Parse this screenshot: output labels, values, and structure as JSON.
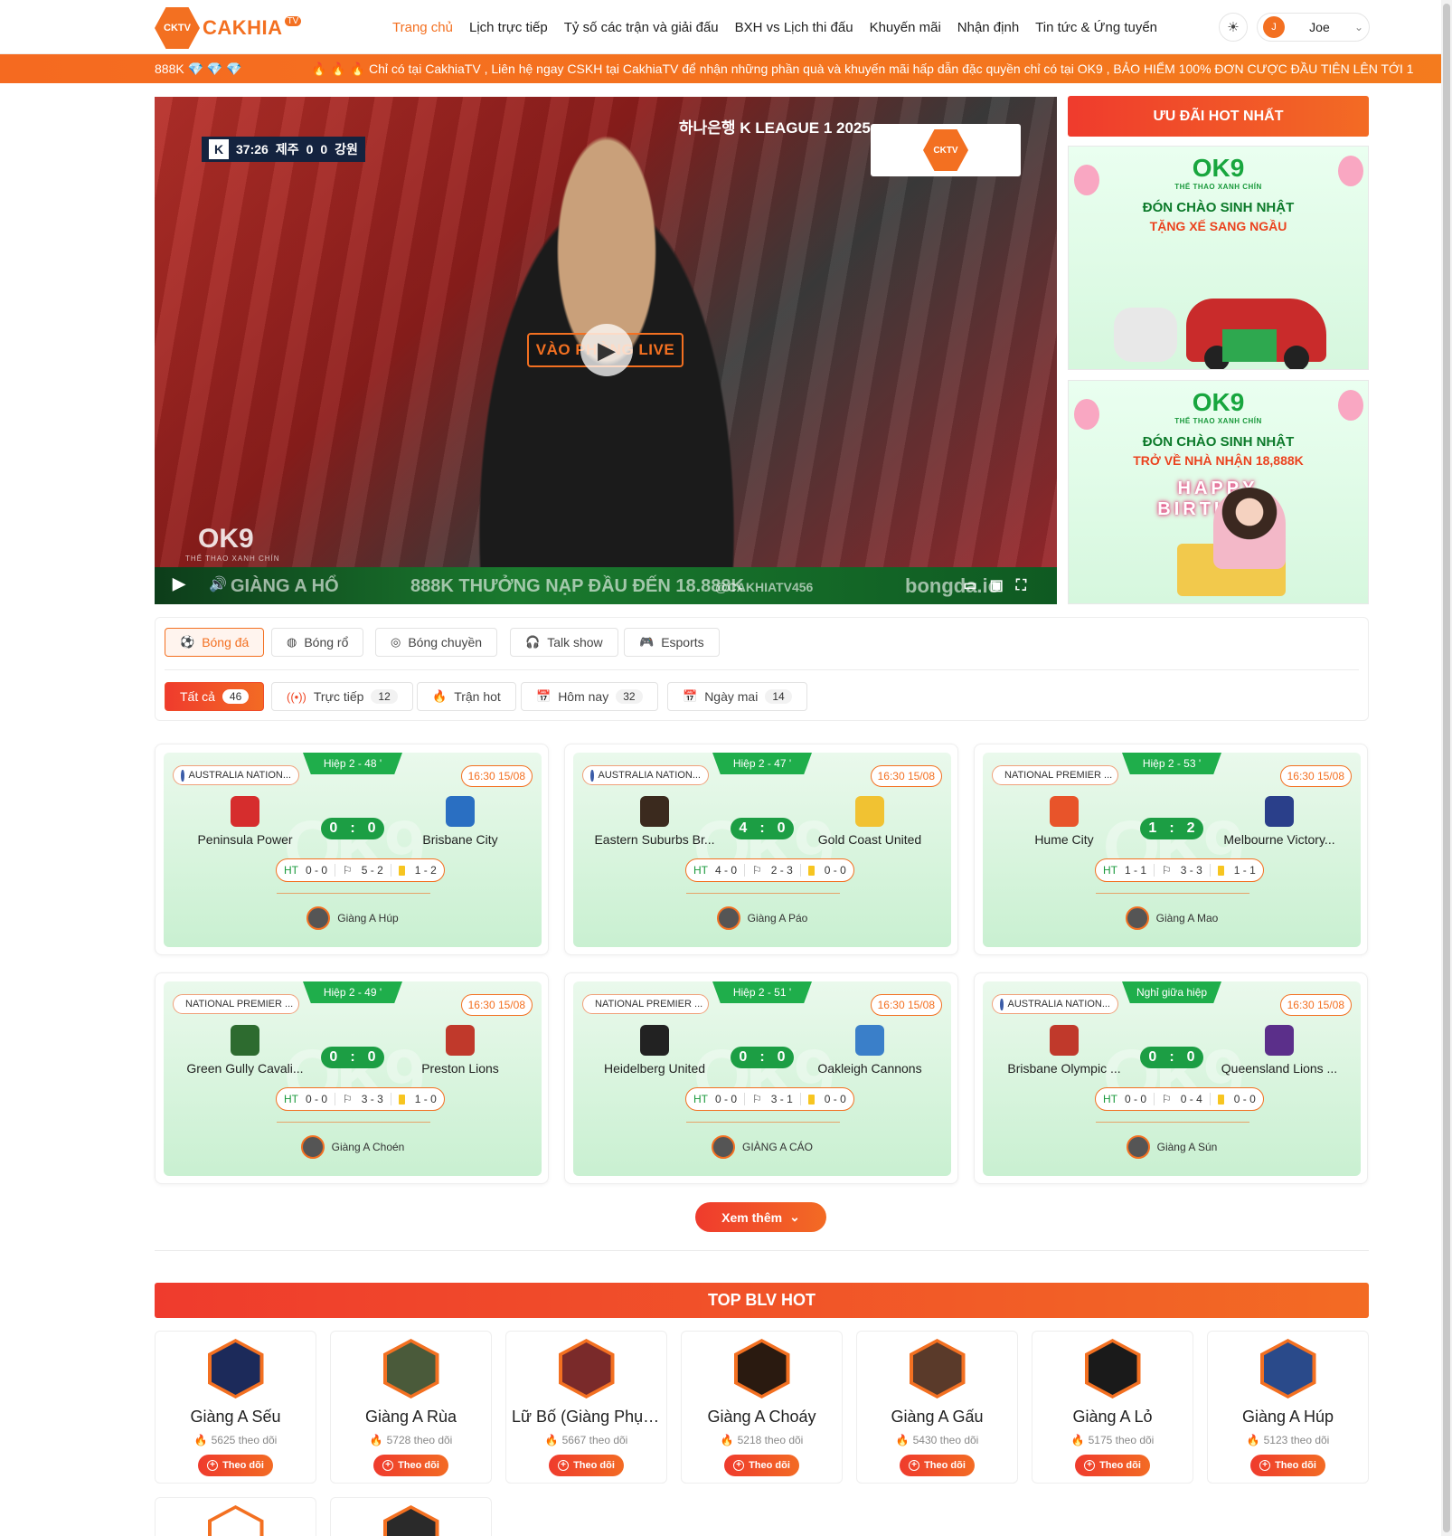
{
  "header": {
    "logo_badge": "CKTV",
    "logo_text": "CAKHIA",
    "logo_tv": "TV",
    "nav": [
      {
        "label": "Trang chủ",
        "active": true
      },
      {
        "label": "Lịch trực tiếp"
      },
      {
        "label": "Tỷ số các trận và giải đấu"
      },
      {
        "label": "BXH vs Lịch thi đấu"
      },
      {
        "label": "Khuyến mãi"
      },
      {
        "label": "Nhận định"
      },
      {
        "label": "Tin tức & Ứng tuyển"
      }
    ],
    "user": {
      "initial": "J",
      "name": "Joe"
    }
  },
  "marquee": {
    "left": "888K 💎 💎 💎",
    "right": "🔥 🔥 🔥 Chỉ có tại CakhiaTV , Liên hệ ngay CSKH tại CakhiaTV để nhận những phần quà và khuyến mãi hấp dẫn đặc quyền chỉ có tại OK9 , BẢO HIỂM 100% ĐƠN CƯỢC ĐẦU TIÊN LÊN TỚI 1"
  },
  "video": {
    "scoreboard": {
      "time": "37:26",
      "home": "제주",
      "home_score": "0",
      "away_score": "0",
      "away": "강원"
    },
    "league_overlay": "하나은행 K LEAGUE 1 2025",
    "live_button": "VÀO PHÒNG LIVE",
    "watermark": "OK9",
    "watermark_sub": "THỂ THAO XANH CHÍN",
    "bar_text_1": "GIÀNG A HỔ",
    "bar_text_2": "888K   THƯỞNG NẠP ĐẦU ĐẾN 18.888K",
    "bar_text_3": "@CAKHIATV456",
    "bar_text_4": "bongda.io"
  },
  "promo": {
    "title": "ƯU ĐÃI HOT NHẤT",
    "banners": [
      {
        "brand": "OK9",
        "sub": "THỂ THAO XANH CHÍN",
        "line1": "ĐÓN CHÀO SINH NHẬT",
        "line2": "TẶNG XẾ SANG NGẦU"
      },
      {
        "brand": "OK9",
        "sub": "THỂ THAO XANH CHÍN",
        "line1": "ĐÓN CHÀO SINH NHẬT",
        "line2": "TRỞ VỀ NHÀ NHẬN 18,888K",
        "art_text": "HAPPY BIRTHDAY"
      }
    ]
  },
  "sports": [
    {
      "label": "Bóng đá",
      "icon": "soccer-icon",
      "selected": true
    },
    {
      "label": "Bóng rổ",
      "icon": "basketball-icon"
    },
    {
      "label": "Bóng chuyền",
      "icon": "volleyball-icon"
    },
    {
      "label": "Talk show",
      "icon": "headset-icon"
    },
    {
      "label": "Esports",
      "icon": "gamepad-icon"
    }
  ],
  "filters": [
    {
      "label": "Tất cả",
      "count": "46",
      "selected": true
    },
    {
      "label": "Trực tiếp",
      "count": "12",
      "icon": "live-icon"
    },
    {
      "label": "Trận hot",
      "icon": "fire-icon"
    },
    {
      "label": "Hôm nay",
      "count": "32",
      "icon": "calendar-icon"
    },
    {
      "label": "Ngày mai",
      "count": "14",
      "icon": "calendar-icon"
    }
  ],
  "matches": [
    {
      "league": "AUSTRALIA NATION...",
      "half": "Hiệp 2 - 48 '",
      "time": "16:30 15/08",
      "home": "Peninsula Power",
      "away": "Brisbane City",
      "home_score": "0",
      "away_score": "0",
      "ht": "0 - 0",
      "corners": "5 - 2",
      "cards": "1 - 2",
      "caster": "Giàng A Húp"
    },
    {
      "league": "AUSTRALIA NATION...",
      "half": "Hiệp 2 - 47 '",
      "time": "16:30 15/08",
      "home": "Eastern Suburbs Br...",
      "away": "Gold Coast United",
      "home_score": "4",
      "away_score": "0",
      "ht": "4 - 0",
      "corners": "2 - 3",
      "cards": "0 - 0",
      "caster": "Giàng A Páo"
    },
    {
      "league": "NATIONAL PREMIER ...",
      "half": "Hiệp 2 - 53 '",
      "time": "16:30 15/08",
      "home": "Hume City",
      "away": "Melbourne Victory...",
      "home_score": "1",
      "away_score": "2",
      "ht": "1 - 1",
      "corners": "3 - 3",
      "cards": "1 - 1",
      "caster": "Giàng A Mao"
    },
    {
      "league": "NATIONAL PREMIER ...",
      "half": "Hiệp 2 - 49 '",
      "time": "16:30 15/08",
      "home": "Green Gully Cavali...",
      "away": "Preston Lions",
      "home_score": "0",
      "away_score": "0",
      "ht": "0 - 0",
      "corners": "3 - 3",
      "cards": "1 - 0",
      "caster": "Giàng A Choén"
    },
    {
      "league": "NATIONAL PREMIER ...",
      "half": "Hiệp 2 - 51 '",
      "time": "16:30 15/08",
      "home": "Heidelberg United",
      "away": "Oakleigh Cannons",
      "home_score": "0",
      "away_score": "0",
      "ht": "0 - 0",
      "corners": "3 - 1",
      "cards": "0 - 0",
      "caster": "GIÀNG A CÁO"
    },
    {
      "league": "AUSTRALIA NATION...",
      "half": "Nghỉ giữa hiệp",
      "time": "16:30 15/08",
      "home": "Brisbane Olympic ...",
      "away": "Queensland Lions ...",
      "home_score": "0",
      "away_score": "0",
      "ht": "0 - 0",
      "corners": "0 - 4",
      "cards": "0 - 0",
      "caster": "Giàng A Sún"
    }
  ],
  "card_watermark": "OK9",
  "ht_label": "HT",
  "more_label": "Xem thêm",
  "blv_title": "TOP BLV HOT",
  "follow_label": "Theo dõi",
  "followers_suffix": "theo dõi",
  "blvs": [
    {
      "name": "Giàng A Sếu",
      "followers": "5625"
    },
    {
      "name": "Giàng A Rùa",
      "followers": "5728"
    },
    {
      "name": "Lữ Bố (Giàng Phụn...",
      "followers": "5667"
    },
    {
      "name": "Giàng A Choáy",
      "followers": "5218"
    },
    {
      "name": "Giàng A Gấu",
      "followers": "5430"
    },
    {
      "name": "Giàng A Lỏ",
      "followers": "5175"
    },
    {
      "name": "Giàng A Húp",
      "followers": "5123"
    }
  ],
  "colors": {
    "brand": "#f37021",
    "accent_red": "#ef3b2d",
    "green": "#1fae4b"
  }
}
